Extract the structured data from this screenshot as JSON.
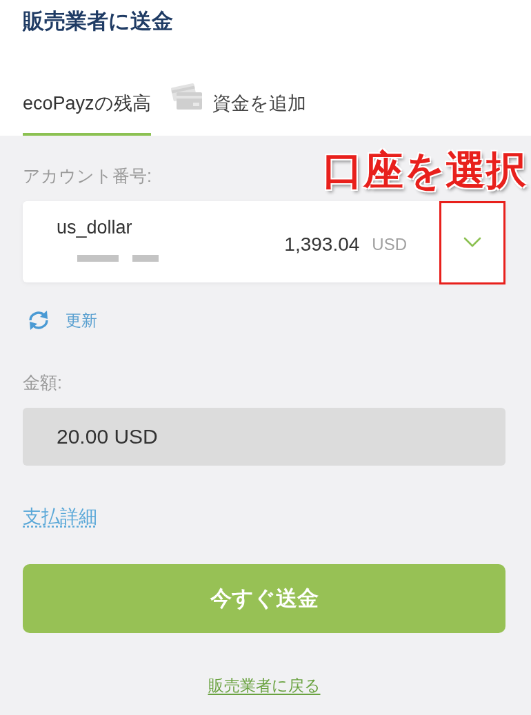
{
  "header": {
    "title": "販売業者に送金"
  },
  "tabs": [
    {
      "label": "ecoPayzの残高",
      "selected": true,
      "kind": "text"
    },
    {
      "label": "資金を追加",
      "selected": false,
      "kind": "card"
    }
  ],
  "account": {
    "label": "アカウント番号:",
    "name": "us_dollar",
    "balance": "1,393.04",
    "currency": "USD",
    "refresh": "更新"
  },
  "annotation": {
    "text": "口座を選択",
    "frame": true
  },
  "amount": {
    "label": "金額:",
    "value": "20.00 USD",
    "disabled": true
  },
  "details_link": "支払詳細",
  "submit_button": "今すぐ送金",
  "back_link": "販売業者に戻る"
}
